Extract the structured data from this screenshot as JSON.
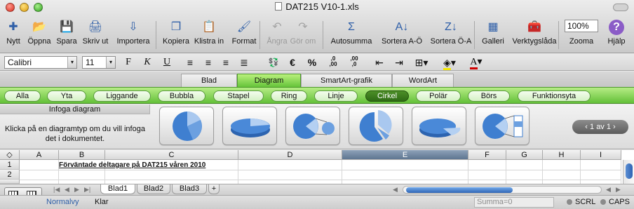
{
  "window": {
    "title": "DAT215 V10-1.xls"
  },
  "toolbar": [
    {
      "label": "Nytt",
      "icon": "new-sheet-icon",
      "enabled": true
    },
    {
      "label": "Öppna",
      "icon": "open-icon",
      "enabled": true
    },
    {
      "label": "Spara",
      "icon": "save-icon",
      "enabled": true
    },
    {
      "label": "Skriv ut",
      "icon": "print-icon",
      "enabled": true
    },
    {
      "label": "Importera",
      "icon": "import-icon",
      "enabled": true
    },
    {
      "label": "Kopiera",
      "icon": "copy-icon",
      "enabled": true
    },
    {
      "label": "Klistra in",
      "icon": "paste-icon",
      "enabled": true
    },
    {
      "label": "Format",
      "icon": "format-brush-icon",
      "enabled": true
    },
    {
      "label": "Ångra",
      "icon": "undo-icon",
      "enabled": false
    },
    {
      "label": "Gör om",
      "icon": "redo-icon",
      "enabled": false
    },
    {
      "label": "Autosumma",
      "icon": "autosum-icon",
      "enabled": true
    },
    {
      "label": "Sortera A-Ö",
      "icon": "sort-ascending-icon",
      "enabled": true
    },
    {
      "label": "Sortera Ö-A",
      "icon": "sort-descending-icon",
      "enabled": true
    },
    {
      "label": "Galleri",
      "icon": "gallery-icon",
      "enabled": true
    },
    {
      "label": "Verktygslåda",
      "icon": "toolbox-icon",
      "enabled": true
    },
    {
      "label": "Zooma",
      "icon": "zoom-icon",
      "enabled": true
    },
    {
      "label": "Hjälp",
      "icon": "help-icon",
      "enabled": true
    }
  ],
  "zoom": "100%",
  "format": {
    "font": "Calibri",
    "size": "11",
    "bold": "F",
    "italic": "K",
    "underline": "U",
    "euro": "€",
    "percent": "%",
    "inc_dec": ",0\n,00",
    "dec_dec": ",00\n,0"
  },
  "ribbon_tabs": [
    {
      "label": "Blad",
      "active": false
    },
    {
      "label": "Diagram",
      "active": true
    },
    {
      "label": "SmartArt-grafik",
      "active": false
    },
    {
      "label": "WordArt",
      "active": false
    }
  ],
  "chart_types": [
    {
      "label": "Alla",
      "active": false
    },
    {
      "label": "Yta",
      "active": false
    },
    {
      "label": "Liggande",
      "active": false
    },
    {
      "label": "Bubbla",
      "active": false
    },
    {
      "label": "Stapel",
      "active": false
    },
    {
      "label": "Ring",
      "active": false
    },
    {
      "label": "Linje",
      "active": false
    },
    {
      "label": "Cirkel",
      "active": true
    },
    {
      "label": "Polär",
      "active": false
    },
    {
      "label": "Börs",
      "active": false
    },
    {
      "label": "Funktionsyta",
      "active": false
    }
  ],
  "insert": {
    "header": "Infoga diagram",
    "text": "Klicka på en diagramtyp om du vill infoga det i dokumentet."
  },
  "gallery_pager": "1 av 1",
  "columns": [
    "A",
    "B",
    "C",
    "D",
    "E",
    "F",
    "G",
    "H",
    "I"
  ],
  "selected_column": "E",
  "rows": [
    "1",
    "2"
  ],
  "cell_b1": "Förväntade deltagare på DAT215 våren 2010",
  "sheet_tabs": [
    {
      "label": "Blad1",
      "active": true
    },
    {
      "label": "Blad2",
      "active": false
    },
    {
      "label": "Blad3",
      "active": false
    }
  ],
  "add_sheet": "+",
  "status": {
    "view": "Normalvy",
    "ready": "Klar",
    "sum": "Summa=0",
    "scrl": "SCRL",
    "caps": "CAPS"
  },
  "colors": {
    "ribbon_green": "#66c43a",
    "selected_col": "#5e7590",
    "chart_blue": "#3f7fd0"
  }
}
